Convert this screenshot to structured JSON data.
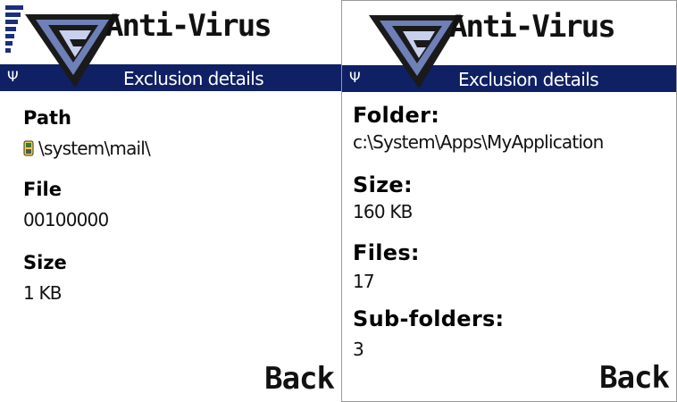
{
  "left_screen": {
    "app_title": "Anti-Virus",
    "subtitle": "Exclusion details",
    "fields": [
      {
        "label": "Path",
        "value": "\\system\\mail\\"
      },
      {
        "label": "File",
        "value": "00100000"
      },
      {
        "label": "Size",
        "value": "1 KB"
      }
    ],
    "softkey": "Back"
  },
  "right_screen": {
    "app_title": "Anti-Virus",
    "subtitle": "Exclusion details",
    "fields": [
      {
        "label": "Folder:",
        "value": "c:\\System\\Apps\\MyApplication"
      },
      {
        "label": "Size:",
        "value": "160 KB"
      },
      {
        "label": "Files:",
        "value": "17"
      },
      {
        "label": "Sub-folders:",
        "value": "3"
      }
    ],
    "softkey": "Back"
  },
  "colors": {
    "bar": "#0f2064",
    "logo_dark": "#1a1a1a",
    "logo_blue": "#6f7fb8"
  },
  "icons": [
    "signal-strength-icon",
    "antenna-icon",
    "anti-virus-logo-icon",
    "phone-memory-icon"
  ]
}
